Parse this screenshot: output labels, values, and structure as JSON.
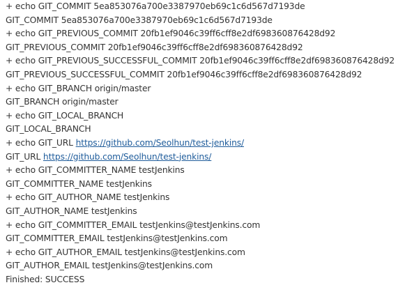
{
  "console": {
    "lines": [
      {
        "text": "+ echo GIT_COMMIT 5ea853076a700e3387970eb69c1c6d567d7193de"
      },
      {
        "text": "GIT_COMMIT 5ea853076a700e3387970eb69c1c6d567d7193de"
      },
      {
        "text": "+ echo GIT_PREVIOUS_COMMIT 20fb1ef9046c39ff6cff8e2df698360876428d92"
      },
      {
        "text": "GIT_PREVIOUS_COMMIT 20fb1ef9046c39ff6cff8e2df698360876428d92"
      },
      {
        "text": "+ echo GIT_PREVIOUS_SUCCESSFUL_COMMIT 20fb1ef9046c39ff6cff8e2df698360876428d92"
      },
      {
        "text": "GIT_PREVIOUS_SUCCESSFUL_COMMIT 20fb1ef9046c39ff6cff8e2df698360876428d92"
      },
      {
        "text": "+ echo GIT_BRANCH origin/master"
      },
      {
        "text": "GIT_BRANCH origin/master"
      },
      {
        "text": "+ echo GIT_LOCAL_BRANCH"
      },
      {
        "text": "GIT_LOCAL_BRANCH"
      },
      {
        "prefix": "+ echo GIT_URL ",
        "link": "https://github.com/Seolhun/test-jenkins/"
      },
      {
        "prefix": "GIT_URL ",
        "link": "https://github.com/Seolhun/test-jenkins/"
      },
      {
        "text": "+ echo GIT_COMMITTER_NAME testJenkins"
      },
      {
        "text": "GIT_COMMITTER_NAME testJenkins"
      },
      {
        "text": "+ echo GIT_AUTHOR_NAME testJenkins"
      },
      {
        "text": "GIT_AUTHOR_NAME testJenkins"
      },
      {
        "text": "+ echo GIT_COMMITTER_EMAIL testJenkins@testJenkins.com"
      },
      {
        "text": "GIT_COMMITTER_EMAIL testJenkins@testJenkins.com"
      },
      {
        "text": "+ echo GIT_AUTHOR_EMAIL testJenkins@testJenkins.com"
      },
      {
        "text": "GIT_AUTHOR_EMAIL testJenkins@testJenkins.com"
      },
      {
        "text": "Finished: SUCCESS"
      }
    ]
  },
  "colors": {
    "text": "#333333",
    "link": "#1f5c9b",
    "background": "#ffffff"
  }
}
